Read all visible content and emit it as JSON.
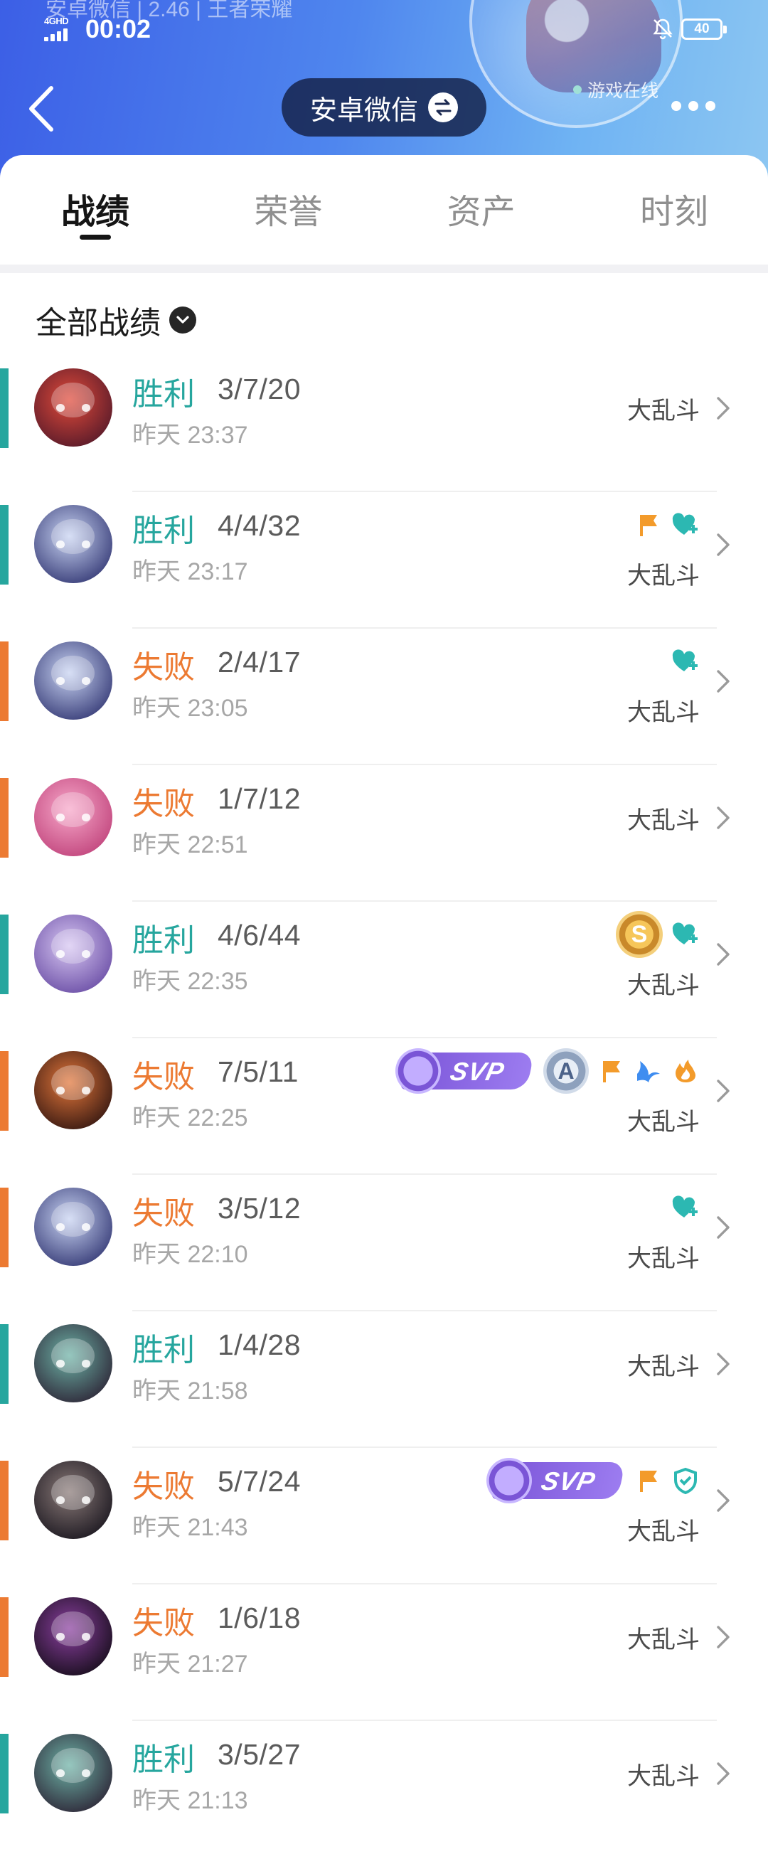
{
  "colors": {
    "win": "#26a69e",
    "loss": "#ec7a32",
    "header_start": "#3c5fe6",
    "header_end": "#8cc6f2"
  },
  "status_bar": {
    "network": "4GHD",
    "time": "00:02",
    "battery": "40",
    "prev_line": "安卓微信 | 2.46 | 王者荣耀",
    "mute_icon": "bell-off-icon"
  },
  "header": {
    "account_label": "安卓微信",
    "account_icon": "swap-icon",
    "online_status": "游戏在线",
    "back_icon": "chevron-left-icon",
    "more_icon": "more-dots-icon"
  },
  "tabs": [
    {
      "label": "战绩",
      "active": true
    },
    {
      "label": "荣誉",
      "active": false
    },
    {
      "label": "资产",
      "active": false
    },
    {
      "label": "时刻",
      "active": false
    }
  ],
  "filter": {
    "label": "全部战绩",
    "icon": "caret-down-icon"
  },
  "matches": [
    {
      "result": "胜利",
      "win": true,
      "kda": "3/7/20",
      "time": "昨天 23:37",
      "mode": "大乱斗",
      "badges": [],
      "avatar": [
        "#e14a3a",
        "#5a1b2a"
      ]
    },
    {
      "result": "胜利",
      "win": true,
      "kda": "4/4/32",
      "time": "昨天 23:17",
      "mode": "大乱斗",
      "badges": [
        "flag",
        "heart"
      ],
      "avatar": [
        "#c8d3f2",
        "#3a3f7a"
      ]
    },
    {
      "result": "失败",
      "win": false,
      "kda": "2/4/17",
      "time": "昨天 23:05",
      "mode": "大乱斗",
      "badges": [
        "heart"
      ],
      "avatar": [
        "#c8d3f2",
        "#3a3f7a"
      ]
    },
    {
      "result": "失败",
      "win": false,
      "kda": "1/7/12",
      "time": "昨天 22:51",
      "mode": "大乱斗",
      "badges": [],
      "avatar": [
        "#f7a7c9",
        "#c2477e"
      ]
    },
    {
      "result": "胜利",
      "win": true,
      "kda": "4/6/44",
      "time": "昨天 22:35",
      "mode": "大乱斗",
      "badges": [
        "s",
        "heart"
      ],
      "avatar": [
        "#d7c6f2",
        "#6e52a8"
      ]
    },
    {
      "result": "失败",
      "win": false,
      "kda": "7/5/11",
      "time": "昨天 22:25",
      "mode": "大乱斗",
      "badges": [
        "svp",
        "a",
        "flag",
        "leaf",
        "fire"
      ],
      "avatar": [
        "#e2763a",
        "#3a1a12"
      ]
    },
    {
      "result": "失败",
      "win": false,
      "kda": "3/5/12",
      "time": "昨天 22:10",
      "mode": "大乱斗",
      "badges": [
        "heart"
      ],
      "avatar": [
        "#c8d3f2",
        "#3a3f7a"
      ]
    },
    {
      "result": "胜利",
      "win": true,
      "kda": "1/4/28",
      "time": "昨天 21:58",
      "mode": "大乱斗",
      "badges": [],
      "avatar": [
        "#6db2a6",
        "#2f2a3a"
      ]
    },
    {
      "result": "失败",
      "win": false,
      "kda": "5/7/24",
      "time": "昨天 21:43",
      "mode": "大乱斗",
      "badges": [
        "svp",
        "flag",
        "shield"
      ],
      "avatar": [
        "#8a7a78",
        "#1e1a22"
      ]
    },
    {
      "result": "失败",
      "win": false,
      "kda": "1/6/18",
      "time": "昨天 21:27",
      "mode": "大乱斗",
      "badges": [],
      "avatar": [
        "#8b3fa0",
        "#1a0f1f"
      ]
    },
    {
      "result": "胜利",
      "win": true,
      "kda": "3/5/27",
      "time": "昨天 21:13",
      "mode": "大乱斗",
      "badges": [],
      "avatar": [
        "#6db2a6",
        "#2f2a3a"
      ]
    }
  ],
  "badge_text": {
    "svp": "SVP",
    "a": "A",
    "s": "S"
  }
}
